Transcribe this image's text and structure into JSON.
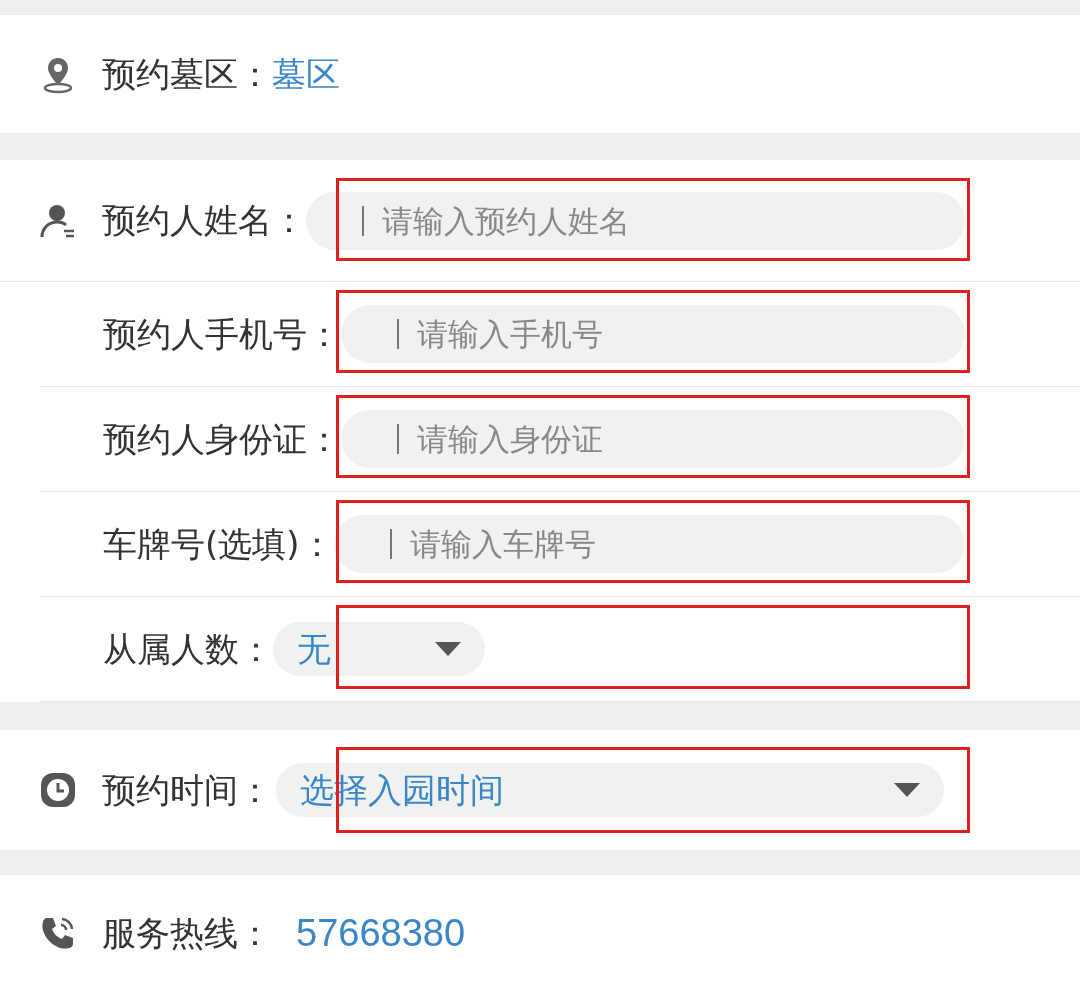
{
  "appointment_area": {
    "label": "预约墓区：",
    "value": "墓区"
  },
  "applicant_fields": [
    {
      "kind": "input",
      "label": "预约人姓名：",
      "placeholder": "请输入预约人姓名",
      "highlighted": true
    },
    {
      "kind": "input",
      "label": "预约人手机号：",
      "placeholder": "请输入手机号",
      "highlighted": true
    },
    {
      "kind": "input",
      "label": "预约人身份证：",
      "placeholder": "请输入身份证",
      "highlighted": true
    },
    {
      "kind": "input",
      "label": "车牌号(选填)：",
      "placeholder": "请输入车牌号",
      "highlighted": true
    },
    {
      "kind": "select",
      "label": "从属人数：",
      "value": "无",
      "highlighted": true
    }
  ],
  "appointment_time": {
    "label": "预约时间：",
    "value": "选择入园时间",
    "highlighted": true
  },
  "hotline": {
    "label": "服务热线：",
    "value": "57668380"
  }
}
